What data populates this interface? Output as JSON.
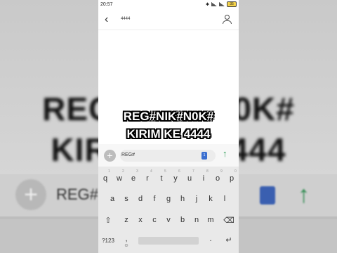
{
  "status_bar": {
    "time": "20:57",
    "battery": "35"
  },
  "app_bar": {
    "title": "4444"
  },
  "caption": {
    "line1": "REG#NIK#N0K#",
    "line2": "KIRIM KE 4444"
  },
  "compose": {
    "value": "REG#",
    "sim_label": "1"
  },
  "keyboard": {
    "row1": [
      "q",
      "w",
      "e",
      "r",
      "t",
      "y",
      "u",
      "i",
      "o",
      "p"
    ],
    "row1_hints": [
      "1",
      "2",
      "3",
      "4",
      "5",
      "6",
      "7",
      "8",
      "9",
      "0"
    ],
    "row2": [
      "a",
      "s",
      "d",
      "f",
      "g",
      "h",
      "j",
      "k",
      "l"
    ],
    "row3": [
      "z",
      "x",
      "c",
      "v",
      "b",
      "n",
      "m"
    ],
    "symbols_label": "?123",
    "comma": ",",
    "period": "."
  },
  "icons": [
    "back-arrow-icon",
    "contact-icon",
    "plus-icon",
    "sim-icon",
    "send-icon",
    "shift-icon",
    "backspace-icon",
    "emoji-icon",
    "enter-icon"
  ]
}
